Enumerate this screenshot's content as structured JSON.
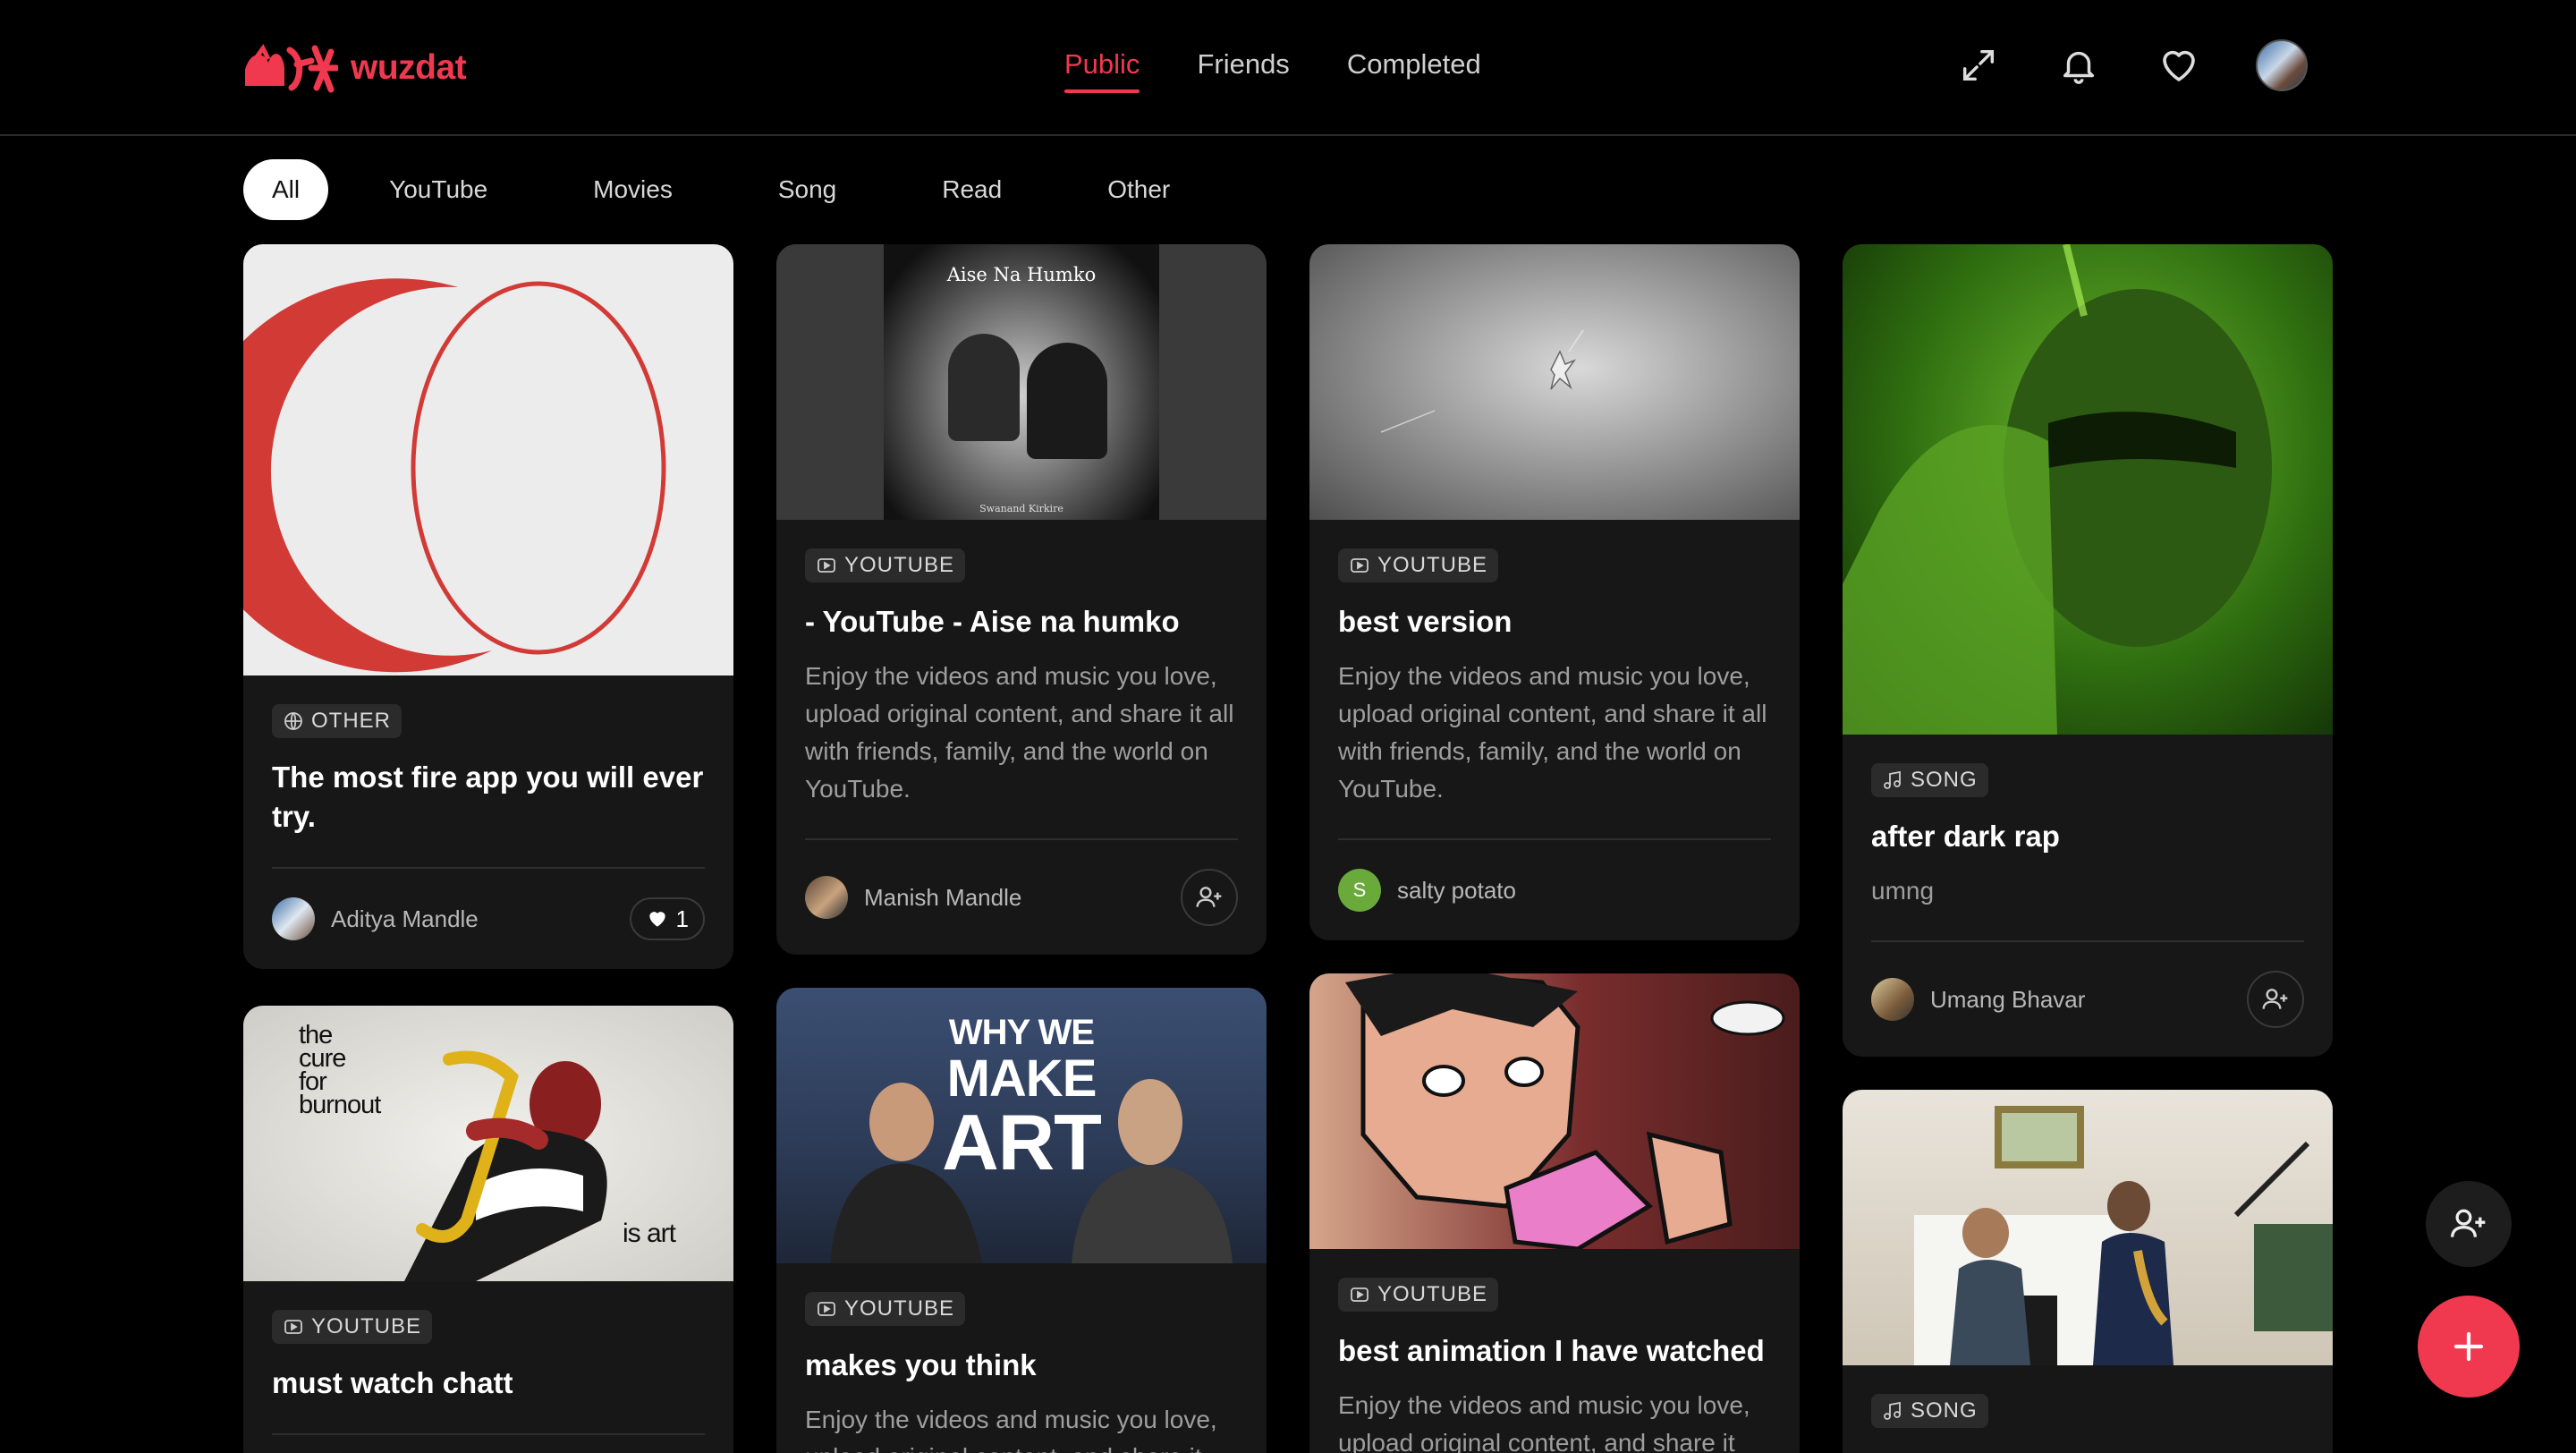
{
  "brand": {
    "name": "wuzdat",
    "accent": "#f0394f"
  },
  "nav": {
    "tabs": [
      {
        "label": "Public",
        "active": true
      },
      {
        "label": "Friends",
        "active": false
      },
      {
        "label": "Completed",
        "active": false
      }
    ]
  },
  "header_icons": [
    "expand-icon",
    "bell-icon",
    "heart-icon",
    "profile-avatar"
  ],
  "filters": {
    "items": [
      {
        "label": "All",
        "active": true
      },
      {
        "label": "YouTube"
      },
      {
        "label": "Movies"
      },
      {
        "label": "Song"
      },
      {
        "label": "Read"
      },
      {
        "label": "Other"
      }
    ]
  },
  "cards": [
    {
      "category": "OTHER",
      "category_icon": "globe-icon",
      "title": "The most fire app you will ever try.",
      "user": "Aditya Mandle",
      "likes": "1"
    },
    {
      "category": "YOUTUBE",
      "category_icon": "video-icon",
      "thumb_title": "Aise Na Humko",
      "thumb_credit": "Swanand Kirkire",
      "title": "- YouTube - Aise na humko",
      "desc": "Enjoy the videos and music you love, upload original content, and share it all with friends, family, and the world on YouTube.",
      "user": "Manish Mandle"
    },
    {
      "category": "YOUTUBE",
      "category_icon": "video-icon",
      "title": "best version",
      "desc": "Enjoy the videos and music you love, upload original content, and share it all with friends, family, and the world on YouTube.",
      "user": "salty potato",
      "user_initial": "S"
    },
    {
      "category": "SONG",
      "category_icon": "music-note-icon",
      "title": "after dark rap",
      "desc": "umng",
      "user": "Umang Bhavar"
    },
    {
      "category": "YOUTUBE",
      "category_icon": "video-icon",
      "thumb_lines": [
        "the",
        "cure",
        "for",
        "burnout"
      ],
      "thumb_tail": "is art",
      "title": "must watch chatt"
    },
    {
      "category": "YOUTUBE",
      "category_icon": "video-icon",
      "thumb_lines": [
        "WHY WE",
        "MAKE",
        "ART"
      ],
      "title": "makes you think",
      "desc": "Enjoy the videos and music you love, upload original content, and share it"
    },
    {
      "category": "YOUTUBE",
      "category_icon": "video-icon",
      "title": "best animation I have watched",
      "desc": "Enjoy the videos and music you love, upload original content, and share it"
    },
    {
      "category": "SONG",
      "category_icon": "music-note-icon",
      "title": ""
    }
  ],
  "fabs": {
    "follow": "add-friend-icon",
    "create": "plus-icon"
  }
}
